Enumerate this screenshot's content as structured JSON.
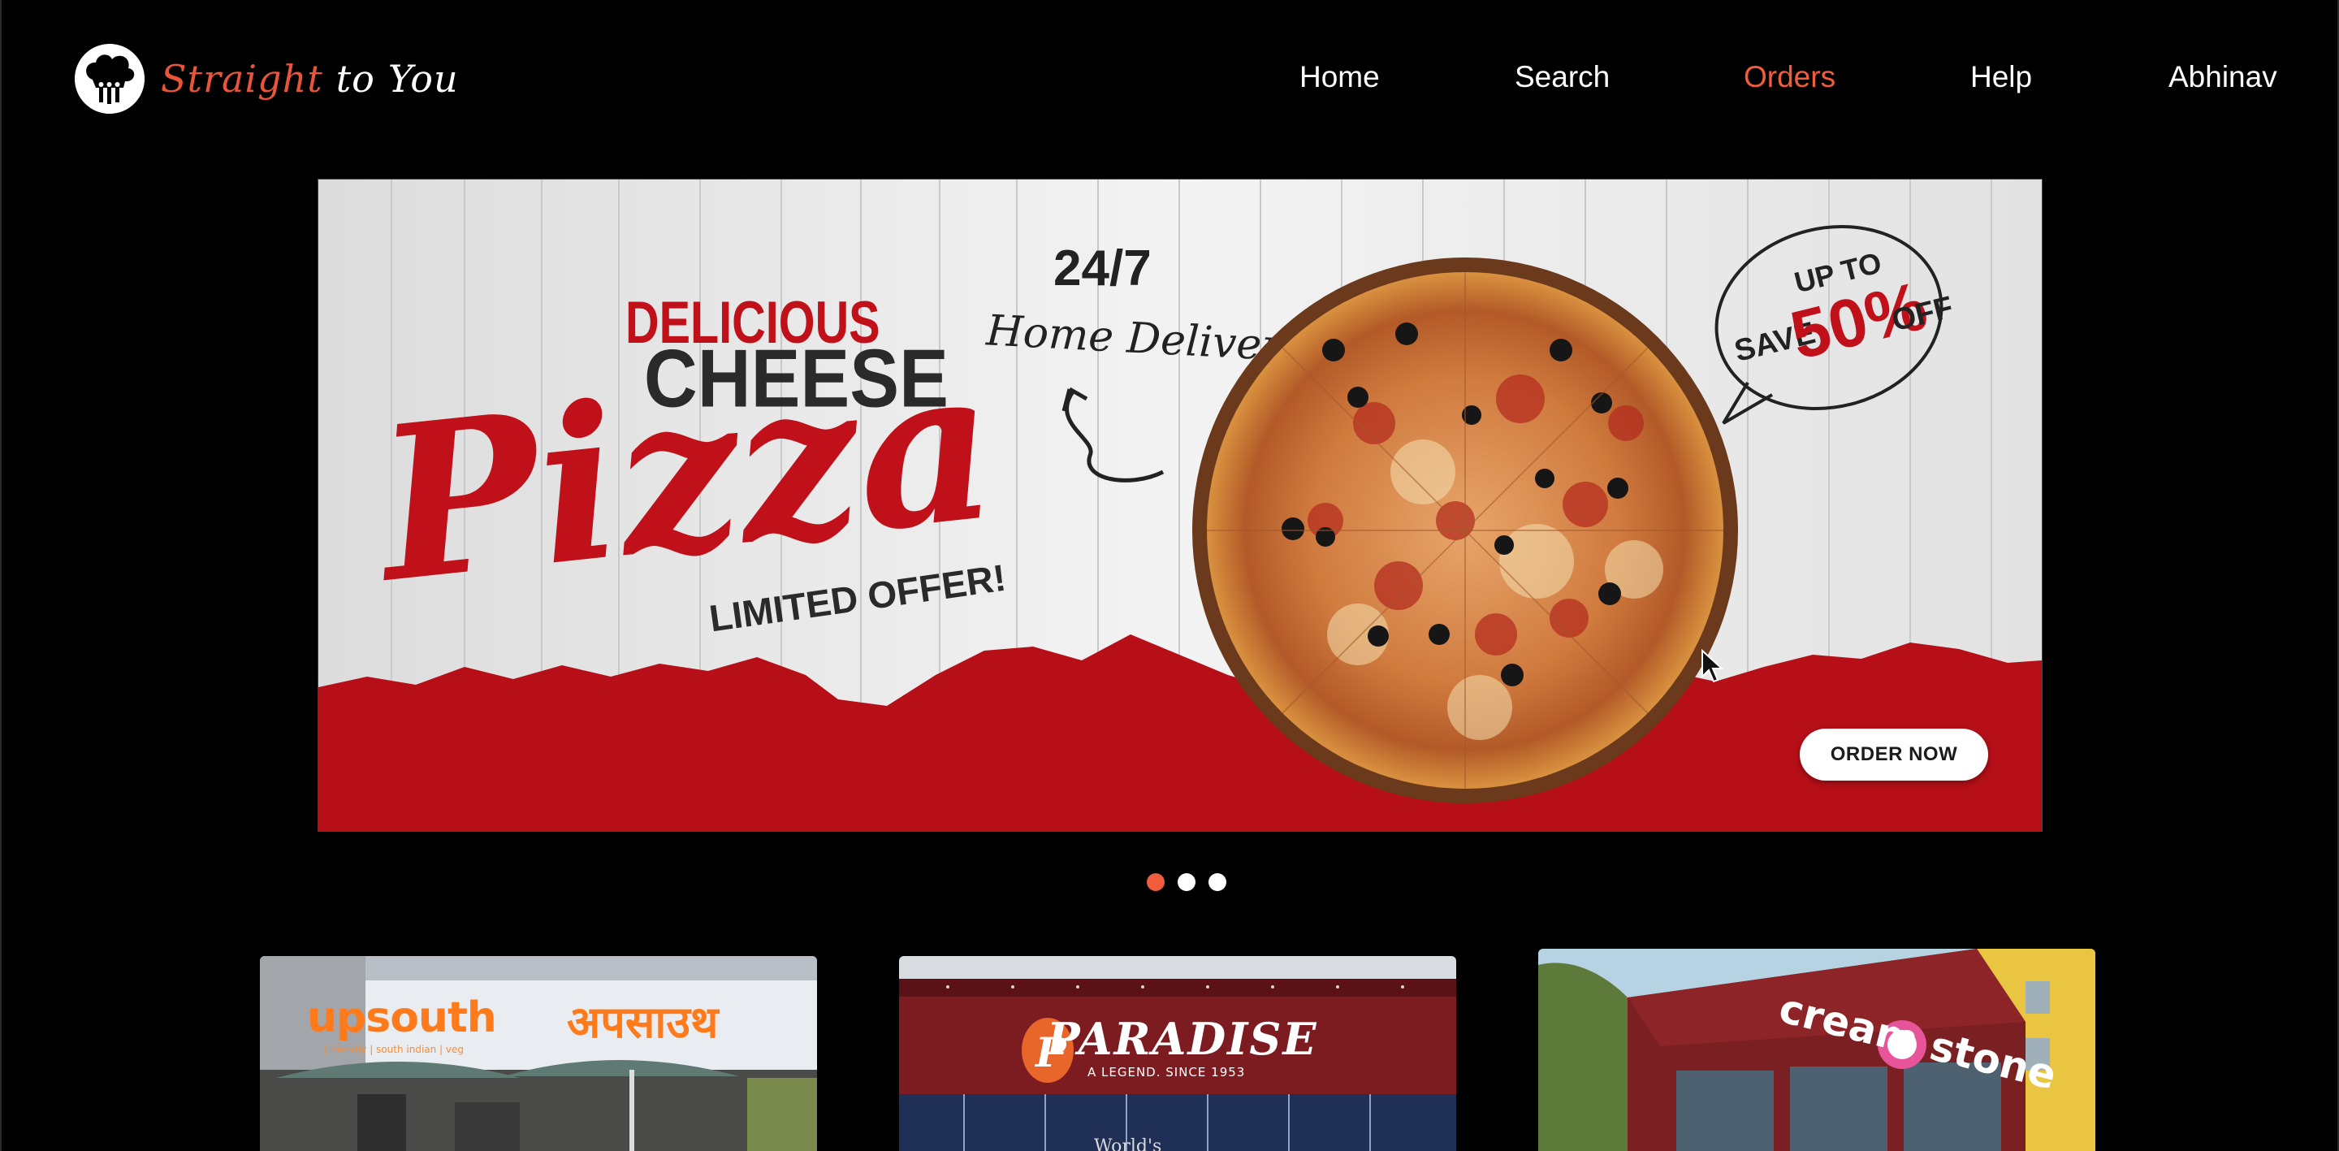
{
  "header": {
    "logo_words": [
      "Straight",
      "to",
      "You"
    ],
    "nav": [
      {
        "label": "Home",
        "active": false
      },
      {
        "label": "Search",
        "active": false
      },
      {
        "label": "Orders",
        "active": true
      },
      {
        "label": "Help",
        "active": false
      },
      {
        "label": "Abhinav",
        "active": false
      }
    ],
    "accent_color": "#ef5d3c"
  },
  "banner": {
    "headline_top": "DELICIOUS",
    "headline_mid": "CHEESE",
    "script_word": "Pizza",
    "tagline": "LIMITED OFFER!",
    "delivery_hours": "24/7",
    "delivery_text": "Home Delivery",
    "offer_prefix": "UP TO",
    "offer_save": "SAVE",
    "offer_value": "50%",
    "offer_suffix": "OFF",
    "cta_label": "ORDER NOW",
    "brand_red": "#c0111b"
  },
  "carousel": {
    "slides": 3,
    "active_index": 0
  },
  "restaurants": [
    {
      "name": "upsouth",
      "name_local": "अपसाउथ",
      "tagline": "| friendly | south indian | veg"
    },
    {
      "name": "PARADISE",
      "tagline": "A LEGEND. SINCE 1953",
      "sign_text": "World's"
    },
    {
      "name": "cream stone"
    }
  ]
}
